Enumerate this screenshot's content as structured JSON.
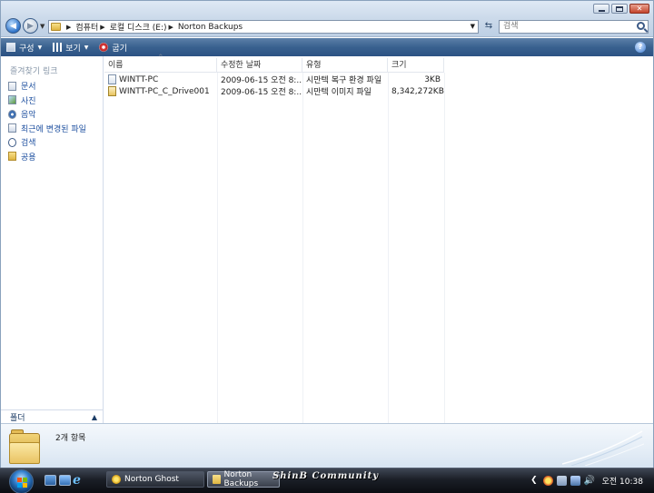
{
  "window": {
    "breadcrumbs": [
      "컴퓨터",
      "로컬 디스크 (E:)",
      "Norton Backups"
    ],
    "search_placeholder": "검색"
  },
  "toolbar": {
    "organize": "구성",
    "views": "보기",
    "burn": "굽기"
  },
  "sidebar": {
    "title": "즐겨찾기 링크",
    "items": [
      {
        "label": "문서",
        "icon": "document-icon"
      },
      {
        "label": "사진",
        "icon": "pictures-icon"
      },
      {
        "label": "음악",
        "icon": "music-icon"
      },
      {
        "label": "최근에 변경된 파일",
        "icon": "recent-files-icon"
      },
      {
        "label": "검색",
        "icon": "search-icon"
      },
      {
        "label": "공용",
        "icon": "public-folder-icon"
      }
    ],
    "folders_label": "폴더"
  },
  "table": {
    "columns": [
      "이름",
      "수정한 날짜",
      "유형",
      "크기"
    ],
    "sorted_column": "이름",
    "rows": [
      {
        "name": "WINTT-PC",
        "date": "2009-06-15 오전 8:...",
        "type": "시만텍 복구 환경 파일",
        "size": "3KB"
      },
      {
        "name": "WINTT-PC_C_Drive001",
        "date": "2009-06-15 오전 8:...",
        "type": "시만텍 이미지 파일",
        "size": "8,342,272KB"
      }
    ]
  },
  "details": {
    "item_count": "2개 항목"
  },
  "taskbar": {
    "tasks": [
      {
        "label": "Norton Ghost",
        "active": false
      },
      {
        "label": "Norton Backups",
        "active": true
      }
    ],
    "watermark": "ShinB Community",
    "clock": "오전 10:38"
  }
}
